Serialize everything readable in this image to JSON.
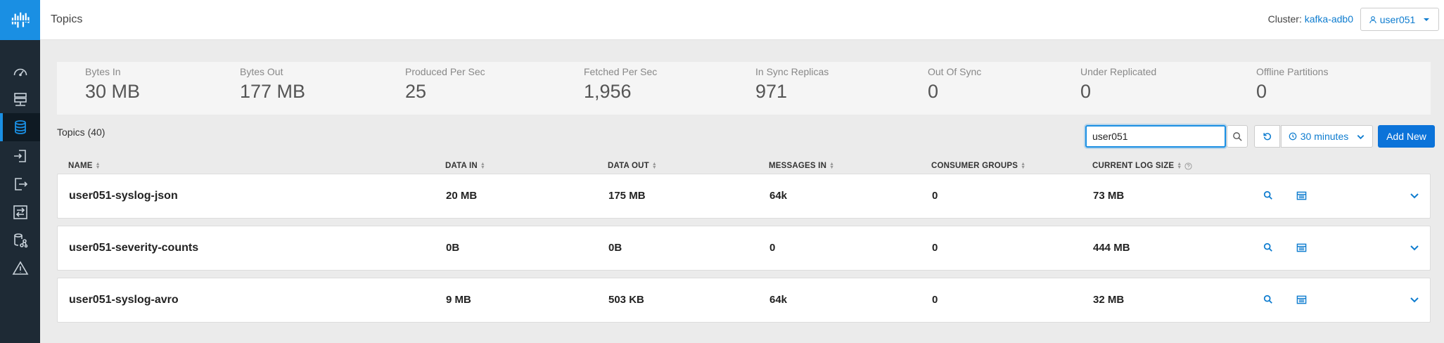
{
  "header": {
    "title": "Topics",
    "cluster_label": "Cluster:",
    "cluster_name": "kafka-adb0",
    "user": "user051"
  },
  "sidebar": {
    "items": [
      {
        "icon": "dashboard-gauge-icon"
      },
      {
        "icon": "brokers-icon"
      },
      {
        "icon": "topics-database-icon",
        "active": true
      },
      {
        "icon": "producers-icon"
      },
      {
        "icon": "consumers-icon"
      },
      {
        "icon": "replication-icon"
      },
      {
        "icon": "connect-icon"
      },
      {
        "icon": "alerts-warning-icon"
      }
    ]
  },
  "stats": [
    {
      "label": "Bytes In",
      "value": "30 MB"
    },
    {
      "label": "Bytes Out",
      "value": "177 MB"
    },
    {
      "label": "Produced Per Sec",
      "value": "25"
    },
    {
      "label": "Fetched Per Sec",
      "value": "1,956"
    },
    {
      "label": "In Sync Replicas",
      "value": "971"
    },
    {
      "label": "Out Of Sync",
      "value": "0"
    },
    {
      "label": "Under Replicated",
      "value": "0"
    },
    {
      "label": "Offline Partitions",
      "value": "0"
    }
  ],
  "toolbar": {
    "topics_count": "Topics (40)",
    "search_value": "user051",
    "time_range": "30 minutes",
    "add_label": "Add New"
  },
  "table": {
    "columns": [
      "NAME",
      "DATA IN",
      "DATA OUT",
      "MESSAGES IN",
      "CONSUMER GROUPS",
      "CURRENT LOG SIZE"
    ],
    "rows": [
      {
        "name": "user051-syslog-json",
        "data_in": "20 MB",
        "data_out": "175 MB",
        "messages_in": "64k",
        "consumer_groups": "0",
        "log_size": "73 MB"
      },
      {
        "name": "user051-severity-counts",
        "data_in": "0B",
        "data_out": "0B",
        "messages_in": "0",
        "consumer_groups": "0",
        "log_size": "444 MB"
      },
      {
        "name": "user051-syslog-avro",
        "data_in": "9 MB",
        "data_out": "503 KB",
        "messages_in": "64k",
        "consumer_groups": "0",
        "log_size": "32 MB"
      }
    ]
  },
  "colors": {
    "accent": "#1a8fe3",
    "sidebar_bg": "#1e2a35",
    "primary_button": "#0b73d9"
  }
}
